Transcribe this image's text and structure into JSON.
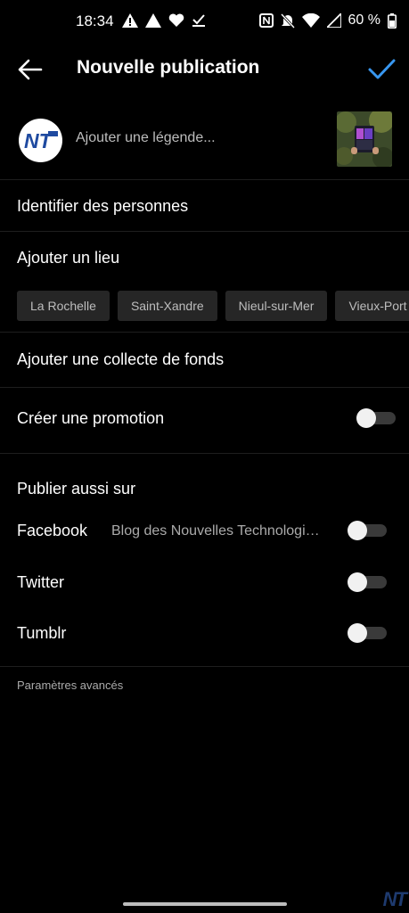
{
  "status_bar": {
    "time": "18:34",
    "battery": "60 %"
  },
  "header": {
    "title": "Nouvelle publication"
  },
  "composer": {
    "avatar_text": "NT",
    "caption_placeholder": "Ajouter une légende..."
  },
  "menu": {
    "tag_people": "Identifier des personnes",
    "add_location": "Ajouter un lieu",
    "location_suggestions": [
      "La Rochelle",
      "Saint-Xandre",
      "Nieul-sur-Mer",
      "Vieux-Port d"
    ],
    "add_fundraiser": "Ajouter une collecte de fonds",
    "create_promotion": "Créer une promotion"
  },
  "share": {
    "section_title": "Publier aussi sur",
    "facebook": {
      "label": "Facebook",
      "page": "Blog des Nouvelles Technologi…"
    },
    "twitter": {
      "label": "Twitter"
    },
    "tumblr": {
      "label": "Tumblr"
    }
  },
  "advanced_settings": "Paramètres avancés",
  "watermark": "NT",
  "colors": {
    "accent": "#3897f0",
    "background": "#000000"
  },
  "icons": [
    "alert-icon",
    "signal-triangle-icon",
    "heart-icon",
    "download-check-icon",
    "nfc-icon",
    "mute-bell-icon",
    "wifi-icon",
    "cell-signal-icon",
    "battery-icon",
    "back-arrow-icon",
    "check-icon"
  ]
}
